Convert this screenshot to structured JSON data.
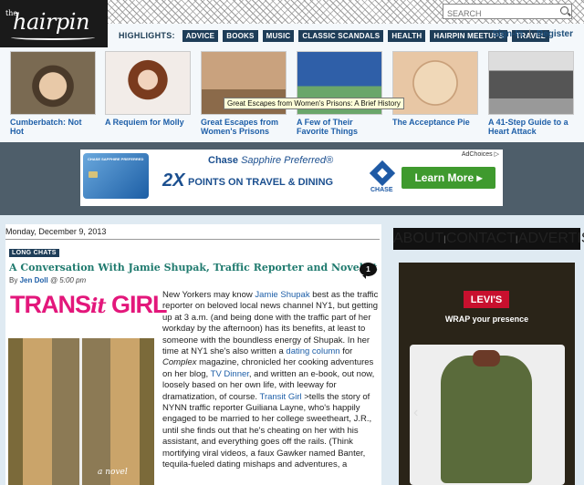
{
  "site": {
    "logo_prefix": "the",
    "logo_name": "hairpin"
  },
  "search": {
    "placeholder": "SEARCH"
  },
  "nav": {
    "highlights_label": "HIGHLIGHTS:",
    "tags": [
      "ADVICE",
      "BOOKS",
      "MUSIC",
      "CLASSIC SCANDALS",
      "HEALTH",
      "HAIRPIN MEETUPS",
      "TRAVEL"
    ],
    "signin": "Sign-In",
    "separator": "|",
    "register": "Register"
  },
  "thumbnails": [
    {
      "caption": "Cumberbatch: Not Hot",
      "bg": "#7a6a52"
    },
    {
      "caption": "A Requiem for Molly",
      "bg": "#f2ece8"
    },
    {
      "caption": "Great Escapes from Women's Prisons",
      "bg": "#b08a68"
    },
    {
      "caption": "A Few of Their Favorite Things",
      "bg": "#3f6aa8"
    },
    {
      "caption": "The Acceptance Pie",
      "bg": "#e8c7a5"
    },
    {
      "caption": "A 41-Step Guide to a Heart Attack",
      "bg": "#a8a8a8"
    }
  ],
  "tooltip": "Great Escapes from Women's Prisons: A Brief History",
  "ad": {
    "adchoices": "AdChoices ▷",
    "card_name": "CHASE SAPPHIRE PREFERRED",
    "title_brand": "Chase",
    "title_product": "Sapphire Preferred®",
    "big": "2X",
    "sub": "POINTS ON TRAVEL & DINING",
    "chase_name": "CHASE",
    "learn_more": "Learn More ▸"
  },
  "article": {
    "date": "Monday, December 9, 2013",
    "badge": "LONG CHATS",
    "title": "A Conversation With Jamie Shupak, Traffic Reporter and Novelist",
    "byline_prefix": "By",
    "author": "Jen Doll",
    "time": "@ 5:00 pm",
    "comments": "1",
    "cover_title_a": "TRANS",
    "cover_title_b": "it",
    "cover_title_c": " GIRL",
    "cover_subtitle": "a novel",
    "body": [
      "New Yorkers may know ",
      "Jamie Shupak",
      " best as the traffic reporter on beloved local news channel NY1, but getting up at 3 a.m. (and being done with the traffic part of her workday by the afternoon) has its benefits, at least to someone with the boundless energy of Shupak. In her time at NY1 she's also written a ",
      "dating column",
      " for ",
      "Complex",
      " magazine, chronicled her cooking adventures on her blog, ",
      "TV Dinner",
      ", and written an e-book, out now, loosely based on her own life, with leeway for dramatization, of course. ",
      "Transit Girl",
      " >tells the story of NYNN traffic reporter Guiliana Layne, who's happily engaged to be married to her college sweetheart, J.R., until she finds out that he's cheating on her with his assistant, and everything goes off the rails. (Think mortifying viral videos, a faux Gawker named Banter, tequila-fueled dating mishaps and adventures, a"
    ]
  },
  "about_tabs": [
    "ABOUT",
    "CONTACT",
    "ADVERTISE"
  ],
  "levis_ad": {
    "logo": "LEVI'S",
    "tagline": "WRAP your presence",
    "arrow": "‹"
  },
  "colors": {
    "nav_tag_bg": "#1e3d58",
    "link_blue": "#1e5fa8",
    "title_teal": "#1f7a6e",
    "ad_band": "#4e5e6a",
    "learn_green": "#3f9a2e",
    "levis_red": "#c8102e"
  }
}
